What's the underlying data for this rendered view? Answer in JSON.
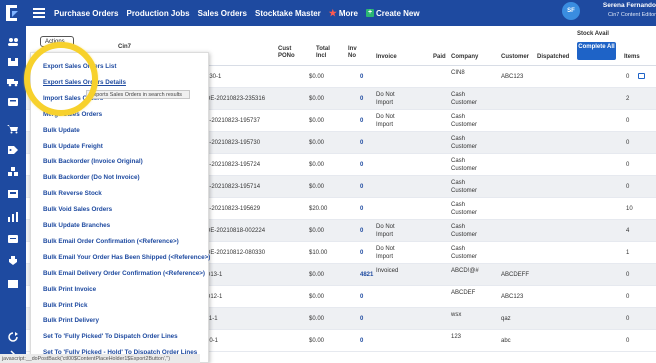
{
  "topbar": {
    "nav": [
      {
        "label": "Purchase Orders"
      },
      {
        "label": "Production Jobs"
      },
      {
        "label": "Sales Orders"
      },
      {
        "label": "Stocktake Master"
      },
      {
        "label": "More"
      },
      {
        "label": "Create New"
      }
    ],
    "user": {
      "initials": "SF",
      "name": "Serena Fernando",
      "role": "Cin7 Content Editor"
    }
  },
  "header": {
    "actions_label": "Actions",
    "cin7_label": "Cin7",
    "cust_pono": "Cust PONo",
    "total_incl": "Total Incl",
    "inv_no": "Inv No",
    "invoice": "Invoice",
    "paid": "Paid",
    "company": "Company",
    "customer": "Customer",
    "dispatched": "Dispatched",
    "stock_avail": "Stock Avail",
    "complete_all": "Complete All",
    "items": "Items"
  },
  "rows": [
    {
      "ref": "330-1",
      "total": "$0.00",
      "inv": "0",
      "invoice": "",
      "company": "CIN8",
      "customer": "ABC123",
      "items": "0",
      "comment": true
    },
    {
      "ref": "DE-20210823-235316",
      "total": "$0.00",
      "inv": "0",
      "invoice": "Do Not Import",
      "company": "Cash Customer",
      "customer": "",
      "items": "2",
      "comment": false
    },
    {
      "ref": "5-20210823-195737",
      "total": "$0.00",
      "inv": "0",
      "invoice": "Do Not Import",
      "company": "Cash Customer",
      "customer": "",
      "items": "0",
      "comment": false
    },
    {
      "ref": "5-20210823-195730",
      "total": "$0.00",
      "inv": "0",
      "invoice": "",
      "company": "Cash Customer",
      "customer": "",
      "items": "0",
      "comment": false
    },
    {
      "ref": "5-20210823-195724",
      "total": "$0.00",
      "inv": "0",
      "invoice": "",
      "company": "Cash Customer",
      "customer": "",
      "items": "0",
      "comment": false
    },
    {
      "ref": "5-20210823-195714",
      "total": "$0.00",
      "inv": "0",
      "invoice": "",
      "company": "Cash Customer",
      "customer": "",
      "items": "0",
      "comment": false
    },
    {
      "ref": "5-20210823-195629",
      "total": "$20.00",
      "inv": "0",
      "invoice": "",
      "company": "Cash Customer",
      "customer": "",
      "items": "10",
      "comment": false
    },
    {
      "ref": "DE-20210818-002224",
      "total": "$0.00",
      "inv": "0",
      "invoice": "Do Not Import",
      "company": "Cash Customer",
      "customer": "",
      "items": "4",
      "comment": false
    },
    {
      "ref": "DE-20210812-080330",
      "total": "$10.00",
      "inv": "0",
      "invoice": "Do Not Import",
      "company": "Cash Customer",
      "customer": "",
      "items": "1",
      "comment": false
    },
    {
      "ref": "D13-1",
      "total": "$0.00",
      "inv": "4821",
      "invoice": "Invoiced",
      "company": "ABCD!@#",
      "customer": "ABCDEFF",
      "items": "0",
      "comment": false
    },
    {
      "ref": "D12-1",
      "total": "$0.00",
      "inv": "0",
      "invoice": "",
      "company": "ABCDEF",
      "customer": "ABC123",
      "items": "0",
      "comment": false
    },
    {
      "ref": "11-1",
      "total": "$0.00",
      "inv": "0",
      "invoice": "",
      "company": "wsx",
      "customer": "qaz",
      "items": "0",
      "comment": false
    },
    {
      "ref": "10-1",
      "total": "$0.00",
      "inv": "0",
      "invoice": "",
      "company": "123",
      "customer": "abc",
      "items": "0",
      "comment": false
    }
  ],
  "menu": {
    "items": [
      "Export Sales Orders List",
      "Export Sales Orders Details",
      "Import Sales Orders",
      "Merge Sales Orders",
      "Bulk Update",
      "Bulk Update Freight",
      "Bulk Backorder (Invoice Original)",
      "Bulk Backorder (Do Not Invoice)",
      "Bulk Reverse Stock",
      "Bulk Void Sales Orders",
      "Bulk Update Branches",
      "Bulk Email Order Confirmation (<Reference>)",
      "Bulk Email Your Order Has Been Shipped (<Reference>)",
      "Bulk Email Delivery Order Confirmation (<Reference>)",
      "Bulk Print Invoice",
      "Bulk Print Pick",
      "Bulk Print Delivery",
      "Set To 'Fully Picked' To Dispatch Order Lines",
      "Set To 'Fully Picked - Hold' To Dispatch Order Lines"
    ],
    "tooltip": "Exports Sales Orders in search results"
  },
  "status_bar": "javascript:__doPostBack('ctl00$ContentPlaceHolder1$Export2Button','')",
  "colors": {
    "brand": "#1e4aa0",
    "highlight": "#f7d12c",
    "button": "#1e63c7"
  }
}
